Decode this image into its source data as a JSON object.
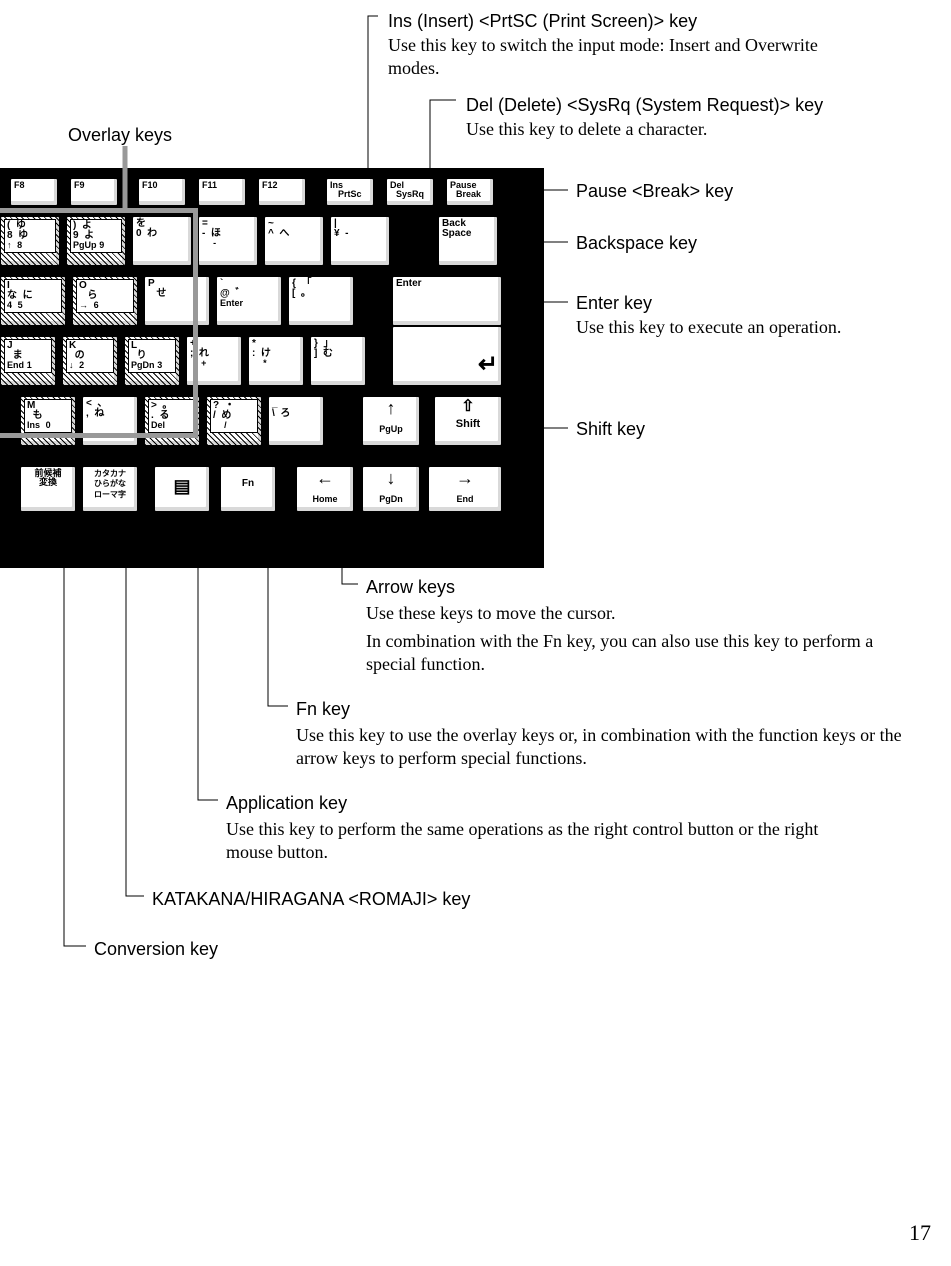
{
  "page_number": "17",
  "overlay_label": "Overlay keys",
  "callouts": {
    "ins": {
      "title": "Ins (Insert) <PrtSC (Print Screen)> key",
      "desc": "Use this key to switch the input mode: Insert and Overwrite modes."
    },
    "del": {
      "title": "Del (Delete) <SysRq (System Request)> key",
      "desc": "Use this key to delete a character."
    },
    "pause": {
      "title": "Pause <Break> key"
    },
    "back": {
      "title": "Backspace key"
    },
    "enter": {
      "title": "Enter key",
      "desc": "Use this key to execute an operation."
    },
    "shift": {
      "title": "Shift key"
    },
    "arrow": {
      "title": "Arrow keys",
      "d1": "Use these keys to move the cursor.",
      "d2": "In combination with the Fn key, you can also use this key to perform a special function."
    },
    "fn": {
      "title": "Fn key",
      "desc": "Use this key to use the overlay keys or, in combination with the function keys or the arrow keys to perform special functions."
    },
    "app": {
      "title": "Application key",
      "desc": "Use this key to perform the same operations as the right control button or the right mouse button."
    },
    "kana": {
      "title": "KATAKANA/HIRAGANA <ROMAJI> key"
    },
    "conv": {
      "title": "Conversion key"
    }
  },
  "keys": {
    "f8": "F8",
    "f9": "F9",
    "f10": "F10",
    "f11": "F11",
    "f12": "F12",
    "ins": "Ins",
    "prtsc": "PrtSc",
    "del": "Del",
    "sysrq": "SysRq",
    "pause": "Pause",
    "break": "Break",
    "backspace_top": "Back",
    "backspace_bot": "Space",
    "enter": "Enter",
    "shift": "Shift",
    "fn": "Fn",
    "home": "Home",
    "end": "End",
    "pgup": "PgUp",
    "pgdn": "PgDn",
    "kana_top": "カタカナ",
    "kana_mid": "ひらがな",
    "kana_bot": "ローマ字",
    "conv_top": "前候補",
    "conv_bot": "変換",
    "r1": {
      "k8": {
        "a": "(",
        "b": "8",
        "c": "ゆ",
        "d": "ゆ",
        "e": "↑",
        "f": "8"
      },
      "k9": {
        "a": ")",
        "b": "9",
        "c": "よ",
        "d": "よ",
        "e": "PgUp",
        "f": "9"
      },
      "k0": {
        "a": "",
        "b": "0",
        "c": "を",
        "d": "わ",
        "e": "",
        "f": ""
      },
      "min": {
        "a": "=",
        "b": "-",
        "c": "",
        "d": "ほ",
        "e": "",
        "f": "-"
      },
      "tilde": {
        "a": "~",
        "b": "^",
        "c": "",
        "d": "へ",
        "e": "",
        "f": ""
      },
      "yen": {
        "a": "|",
        "b": "¥",
        "c": "",
        "d": "-",
        "e": "",
        "f": ""
      }
    },
    "r2": {
      "i": {
        "a": "I",
        "b": "な",
        "c": "に",
        "d": "4",
        "e": "5"
      },
      "o": {
        "a": "O",
        "b": "ら",
        "c": "",
        "d": "→",
        "e": "6"
      },
      "p": {
        "a": "P",
        "b": "",
        "c": "せ",
        "d": "",
        "e": ""
      },
      "at": {
        "a": "`",
        "b": "@",
        "c": "゛",
        "d": "Enter",
        "e": ""
      },
      "lb": {
        "a": "{",
        "b": "[",
        "c": "「",
        "d": "。",
        "e": ""
      }
    },
    "r3": {
      "j": {
        "a": "J",
        "b": "ま",
        "c": "",
        "d": "End",
        "e": "1"
      },
      "k": {
        "a": "K",
        "b": "の",
        "c": "",
        "d": "↓",
        "e": "2"
      },
      "l": {
        "a": "L",
        "b": "り",
        "c": "",
        "d": "PgDn",
        "e": "3"
      },
      "semi": {
        "a": "+",
        "b": ";",
        "c": "れ",
        "d": "",
        "e": "+"
      },
      "colon": {
        "a": "*",
        "b": ":",
        "c": "け",
        "d": "",
        "e": "*"
      },
      "rb": {
        "a": "}",
        "b": "]",
        "c": "」",
        "d": "む",
        "e": ""
      }
    },
    "r4": {
      "m": {
        "a": "M",
        "b": "も",
        "c": "",
        "d": "Ins",
        "e": "0"
      },
      "comma": {
        "a": "<",
        "b": ",",
        "c": "、",
        "d": "ね",
        "e": ""
      },
      "period": {
        "a": ">",
        "b": ".",
        "c": "。",
        "d": "る",
        "e": "Del"
      },
      "slash": {
        "a": "?",
        "b": "/",
        "c": "・",
        "d": "め",
        "e": "/"
      },
      "bs": {
        "a": "_",
        "b": "\\",
        "c": "",
        "d": "ろ",
        "e": ""
      }
    }
  }
}
